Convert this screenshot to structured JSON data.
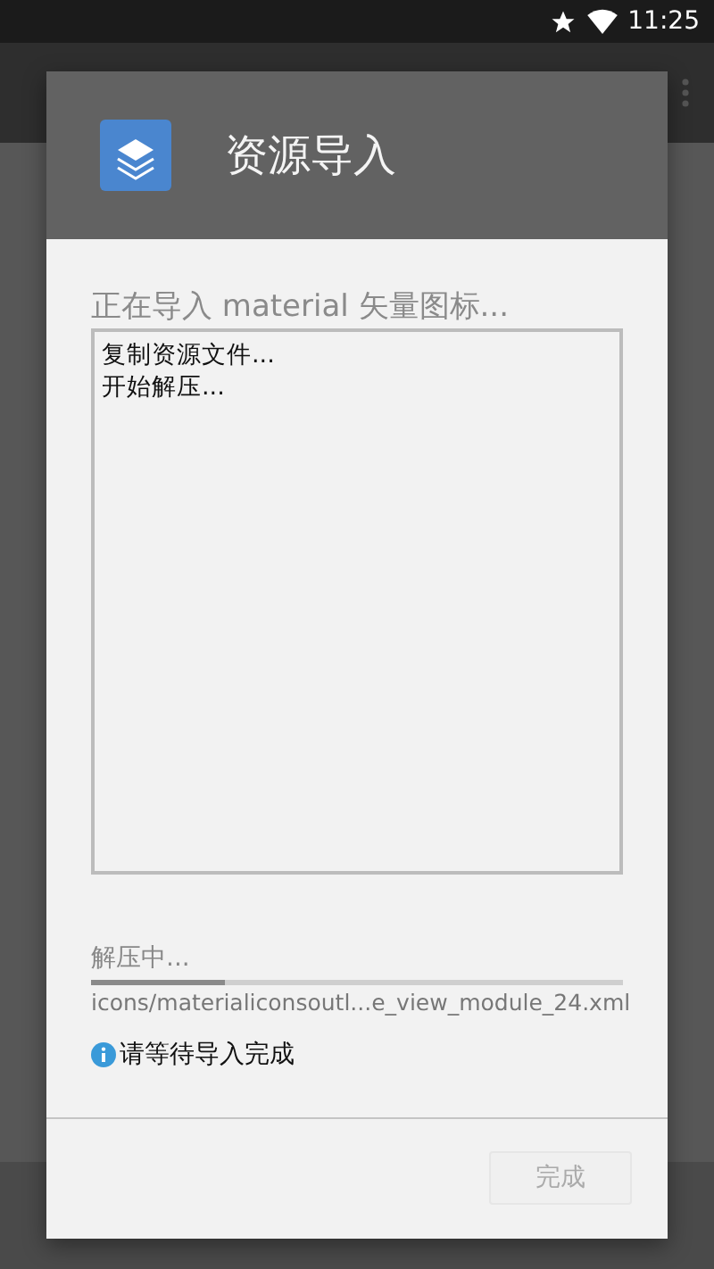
{
  "status_bar": {
    "time": "11:25"
  },
  "dialog": {
    "title": "资源导入",
    "message": "正在导入 material 矢量图标...",
    "log": [
      "复制资源文件...",
      "开始解压..."
    ],
    "progress": {
      "label": "解压中...",
      "level": 0.25,
      "file": "icons/materialiconsoutl...e_view_module_24.xml"
    },
    "notice": "请等待导入完成",
    "buttons": [
      {
        "label": "完成",
        "disabled": true
      }
    ]
  }
}
